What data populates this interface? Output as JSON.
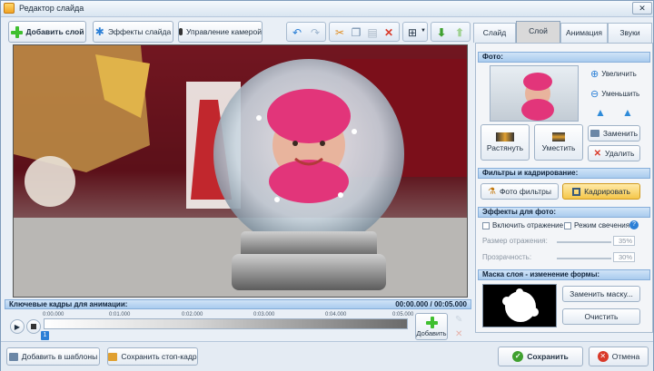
{
  "window": {
    "title": "Редактор слайда"
  },
  "toolbar": {
    "add_layer": "Добавить слой",
    "slide_effects": "Эффекты слайда",
    "camera_control": "Управление камерой"
  },
  "tabs": [
    "Слайд",
    "Слой",
    "Анимация",
    "Звуки"
  ],
  "right_panel": {
    "photo_section": "Фото:",
    "zoom_in": "Увеличить",
    "zoom_out": "Уменьшить",
    "stretch": "Растянуть",
    "fit": "Уместить",
    "replace": "Заменить",
    "delete": "Удалить",
    "filters_section": "Фильтры и кадрирование:",
    "photo_filters": "Фото фильтры",
    "crop": "Кадрировать",
    "effects_section": "Эффекты для фото:",
    "enable_reflection": "Включить отражение",
    "glow_mode": "Режим свечения",
    "reflection_size_label": "Размер отражения:",
    "reflection_size_value": "35%",
    "transparency_label": "Прозрачность:",
    "transparency_value": "30%",
    "mask_section": "Маска слоя - изменение формы:",
    "replace_mask": "Заменить маску...",
    "clear": "Очистить"
  },
  "timeline": {
    "header": "Ключевые кадры для анимации:",
    "time": "00:00.000 / 00:05.000",
    "ticks": [
      "0:00.000",
      "0:01.000",
      "0:02.000",
      "0:03.000",
      "0:04.000",
      "0:05.000"
    ],
    "keyframe_label": "1",
    "add_label": "Добавить"
  },
  "bottom": {
    "add_to_templates": "Добавить в шаблоны",
    "save_freeze": "Сохранить стоп-кадр",
    "save": "Сохранить",
    "cancel": "Отмена"
  },
  "colors": {
    "accent": "#f5c74a",
    "section": "#a9cbee",
    "save_green": "#3fa02f",
    "cancel_red": "#d93a2a"
  }
}
